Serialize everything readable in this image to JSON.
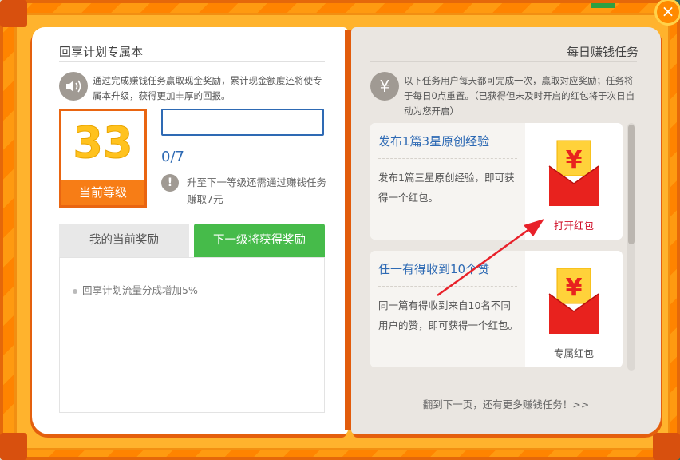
{
  "left_page": {
    "title": "回享计划专属本",
    "description": "通过完成赚钱任务赢取现金奖励，累计现金额度还将使专属本升级，获得更加丰厚的回报。",
    "level": "33",
    "level_label": "当前等级",
    "progress": {
      "current": 0,
      "total": 7,
      "text": "0/7"
    },
    "upgrade_hint": "升至下一等级还需通过赚钱任务赚取7元",
    "tabs": [
      {
        "label": "我的当前奖励"
      },
      {
        "label": "下一级将获得奖励"
      }
    ],
    "active_tab": "下一级将获得奖励",
    "rewards": [
      {
        "text": "回享计划流量分成增加5%"
      }
    ]
  },
  "right_page": {
    "title": "每日赚钱任务",
    "description": "以下任务用户每天都可完成一次，赢取对应奖励；任务将于每日0点重置。（已获得但未及时开启的红包将于次日自动为您开启）",
    "tasks": [
      {
        "title": "发布1篇3星原创经验",
        "description": "发布1篇三星原创经验，即可获得一个红包。",
        "reward_caption": "打开红包",
        "caption_color": "#d0102a",
        "icon": "red-envelope-icon"
      },
      {
        "title": "任一有得收到10个赞",
        "description": "同一篇有得收到来自10名不同用户的赞，即可获得一个红包。",
        "reward_caption": "专属红包",
        "caption_color": "#555555",
        "icon": "red-envelope-icon"
      }
    ],
    "next_page_link": "翻到下一页，还有更多赚钱任务！>>"
  },
  "colors": {
    "accent_orange": "#f77d16",
    "active_tab_green": "#46bb4a",
    "link_blue": "#2e6ab4",
    "envelope_red": "#e8221e",
    "envelope_gold": "#ffd23a"
  }
}
